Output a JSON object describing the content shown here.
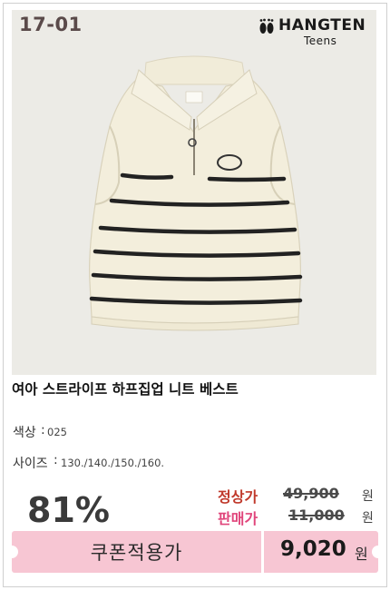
{
  "product_code": "17-01",
  "brand": {
    "name": "HANGTEN",
    "sub": "Teens",
    "logo_icon": "footprints-icon"
  },
  "product_title": "여아 스트라이프 하프집업 니트 베스트",
  "color": {
    "label": "색상",
    "separator": ":",
    "value": "025"
  },
  "size": {
    "label": "사이즈",
    "separator": ":",
    "value": "130./140./150./160."
  },
  "discount_rate": "81%",
  "regular_price": {
    "label": "정상가",
    "value": "49,900",
    "unit": "원",
    "label_color": "#c0392b"
  },
  "sale_price": {
    "label": "판매가",
    "value": "11,000",
    "unit": "원",
    "label_color": "#e0457b"
  },
  "coupon": {
    "label": "쿠폰적용가",
    "price": "9,020",
    "unit": "원",
    "bg_color": "#f7c6d3"
  },
  "colors": {
    "photo_bg": "#ecebe6",
    "knit": "#f3eedc",
    "stripe": "#222222"
  }
}
